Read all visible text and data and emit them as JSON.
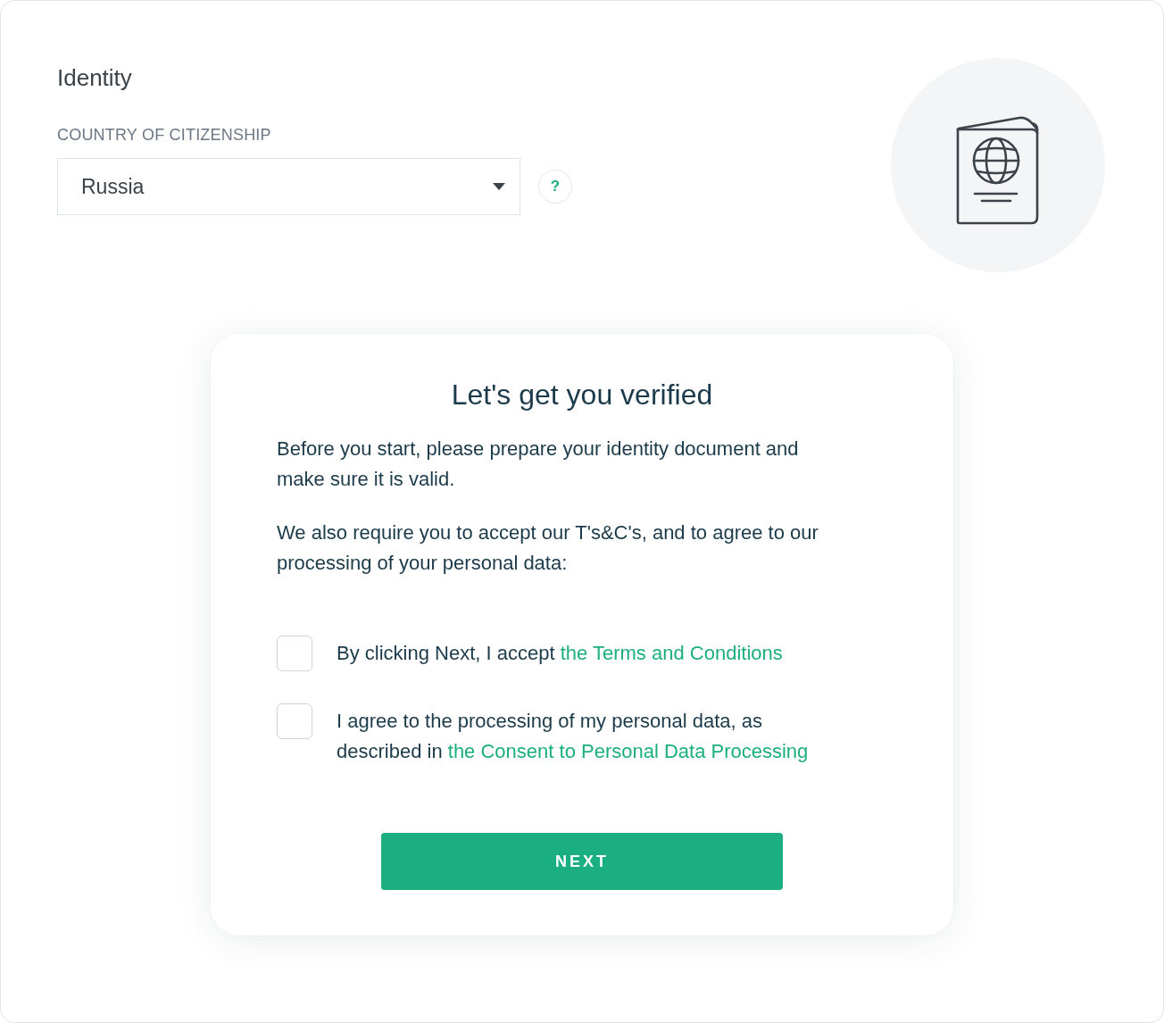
{
  "section": {
    "title": "Identity"
  },
  "country": {
    "label": "COUNTRY OF CITIZENSHIP",
    "value": "Russia",
    "help": "?"
  },
  "modal": {
    "title": "Let's get you verified",
    "paragraphs": [
      "Before you start, please prepare your identity document and make sure it is valid.",
      "We also require you to accept our T's&C's, and to agree to our processing of your personal data:"
    ],
    "consents": [
      {
        "text": "By clicking Next, I accept",
        "link": "the Terms and Conditions",
        "checked": false
      },
      {
        "text": "I agree to the processing of my personal data, as described in",
        "link": "the Consent to Personal Data Processing",
        "checked": false
      }
    ],
    "button": "NEXT"
  }
}
